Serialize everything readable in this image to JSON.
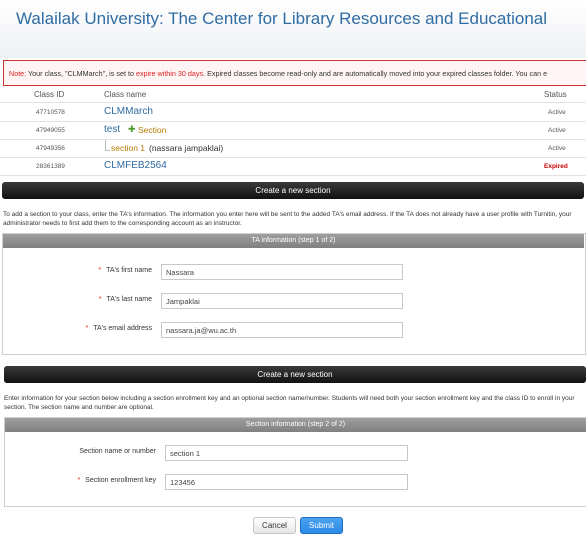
{
  "header": {
    "title": "Walailak University: The Center for Library Resources and Educational"
  },
  "note": {
    "label": "Note:",
    "before": " Your class, \"CLMMarch\", is set to ",
    "highlight": "expire within 30 days",
    "after": ". Expired classes become read-only and are automatically moved into your expired classes folder. You can e"
  },
  "class_table": {
    "headers": {
      "id": "Class ID",
      "name": "Class name",
      "status": "Status"
    },
    "rows": [
      {
        "id": "47710578",
        "name": "CLMMarch",
        "status": "Active"
      },
      {
        "id": "47949055",
        "name": "test",
        "action": "Section",
        "status": "Active"
      },
      {
        "id": "47949356",
        "name": "section 1",
        "owner": "(nassara jampaklai)",
        "status": "Active"
      },
      {
        "id": "28361389",
        "name": "CLMFEB2564",
        "status": "Expired"
      }
    ]
  },
  "create_bar_1": "Create a new section",
  "ta_description": "To add a section to your class, enter the TA's information. The information you enter here will be sent to the added TA's email address. If the TA does not already have a user profile with Turnitin, your administrator needs to first add them to the corresponding account as an instructor.",
  "ta_panel": {
    "title": "TA information (step 1 of 2)",
    "first_name_label": "TA's first name",
    "first_name_value": "Nassara",
    "last_name_label": "TA's last name",
    "last_name_value": "Jampaklai",
    "email_label": "TA's email address",
    "email_value": "nassara.ja@wu.ac.th"
  },
  "create_bar_2": "Create a new section",
  "section_description": "Enter information for your section below including a section enrollment key and an optional section name/number. Students will need both your section enrollment key and the class ID to enroll in your section. The section name and number are optional.",
  "section_panel": {
    "title": "Section information (step 2 of 2)",
    "name_label": "Section name or number",
    "name_value": "section 1",
    "key_label": "Section enrollment key",
    "key_value": "123456"
  },
  "buttons": {
    "cancel": "Cancel",
    "submit": "Submit"
  },
  "colors": {
    "link": "#2f6ca3",
    "expired": "#cc0000",
    "submit": "#2c8ae6"
  }
}
